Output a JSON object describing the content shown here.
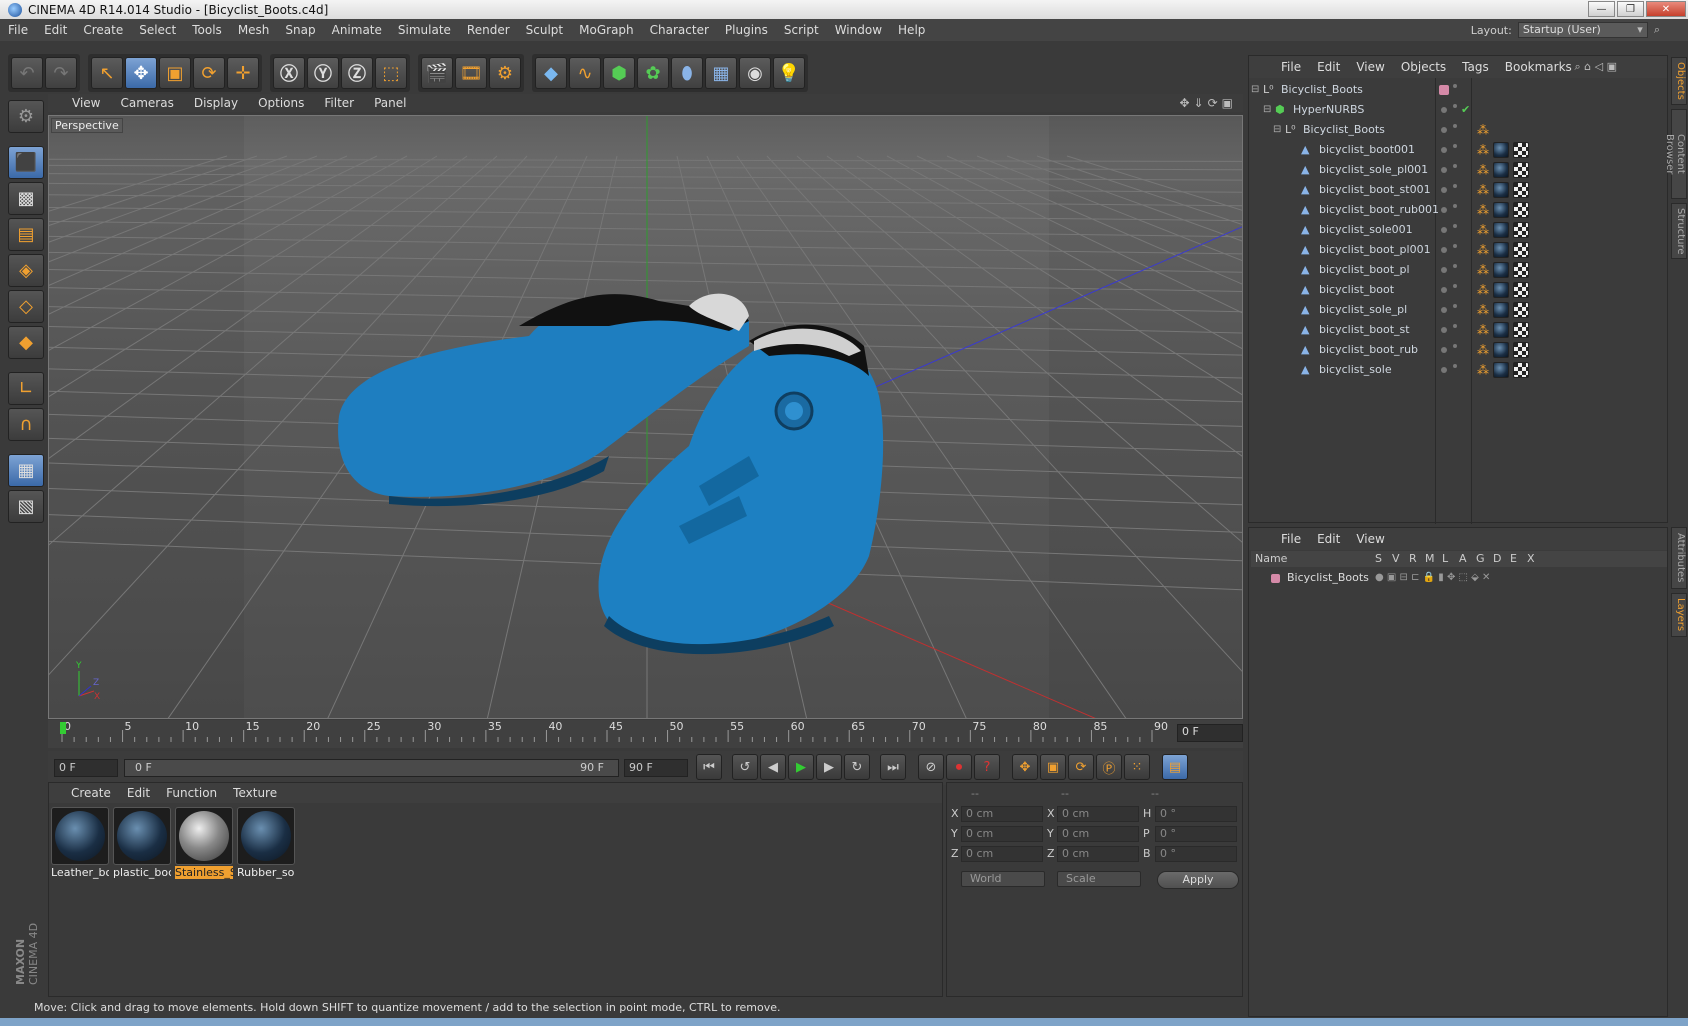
{
  "window": {
    "title": "CINEMA 4D R14.014 Studio - [Bicyclist_Boots.c4d]",
    "buttons": [
      "—",
      "❐",
      "✕"
    ]
  },
  "menubar": {
    "items": [
      "File",
      "Edit",
      "Create",
      "Select",
      "Tools",
      "Mesh",
      "Snap",
      "Animate",
      "Simulate",
      "Render",
      "Sculpt",
      "MoGraph",
      "Character",
      "Plugins",
      "Script",
      "Window",
      "Help"
    ],
    "layout_label": "Layout:",
    "layout_value": "Startup (User)"
  },
  "viewport": {
    "menu": [
      "View",
      "Cameras",
      "Display",
      "Options",
      "Filter",
      "Panel"
    ],
    "label": "Perspective",
    "axis_y": "Y",
    "axis_z": "Z",
    "axis_x": "X",
    "object_color": "#1a78b8"
  },
  "timeline": {
    "ticks": [
      "0",
      "5",
      "10",
      "15",
      "20",
      "25",
      "30",
      "35",
      "40",
      "45",
      "50",
      "55",
      "60",
      "65",
      "70",
      "75",
      "80",
      "85",
      "90"
    ],
    "current_frame": "0 F"
  },
  "transport": {
    "start_field": "0 F",
    "range_start": "0 F",
    "range_end": "90 F",
    "end_field": "90 F"
  },
  "materials": {
    "menu": [
      "Create",
      "Edit",
      "Function",
      "Texture"
    ],
    "items": [
      {
        "label": "Leather_bo",
        "selected": false,
        "kind": "dark"
      },
      {
        "label": "plastic_boc",
        "selected": false,
        "kind": "dark"
      },
      {
        "label": "Stainless_S",
        "selected": true,
        "kind": "steel"
      },
      {
        "label": "Rubber_so",
        "selected": false,
        "kind": "dark"
      }
    ]
  },
  "coordinates": {
    "headers": [
      "--",
      "--",
      "--"
    ],
    "rows": [
      {
        "a": "X",
        "av": "0 cm",
        "b": "X",
        "bv": "0 cm",
        "c": "H",
        "cv": "0 °"
      },
      {
        "a": "Y",
        "av": "0 cm",
        "b": "Y",
        "bv": "0 cm",
        "c": "P",
        "cv": "0 °"
      },
      {
        "a": "Z",
        "av": "0 cm",
        "b": "Z",
        "bv": "0 cm",
        "c": "B",
        "cv": "0 °"
      }
    ],
    "mode1": "World",
    "mode2": "Scale",
    "apply": "Apply"
  },
  "status": "Move: Click and drag to move elements. Hold down SHIFT to quantize movement / add to the selection in point mode, CTRL to remove.",
  "objects": {
    "menu": [
      "File",
      "Edit",
      "View",
      "Objects",
      "Tags",
      "Bookmarks"
    ],
    "rows": [
      {
        "name": "Bicyclist_Boots",
        "indent": 0,
        "type": "null",
        "tags": "layer"
      },
      {
        "name": "HyperNURBS",
        "indent": 1,
        "type": "nurbs",
        "tags": "check"
      },
      {
        "name": "Bicyclist_Boots",
        "indent": 2,
        "type": "null",
        "tags": "phong"
      },
      {
        "name": "bicyclist_boot001",
        "indent": 3,
        "type": "poly",
        "tags": "full"
      },
      {
        "name": "bicyclist_sole_pl001",
        "indent": 3,
        "type": "poly",
        "tags": "full"
      },
      {
        "name": "bicyclist_boot_st001",
        "indent": 3,
        "type": "poly",
        "tags": "full"
      },
      {
        "name": "bicyclist_boot_rub001",
        "indent": 3,
        "type": "poly",
        "tags": "full"
      },
      {
        "name": "bicyclist_sole001",
        "indent": 3,
        "type": "poly",
        "tags": "full"
      },
      {
        "name": "bicyclist_boot_pl001",
        "indent": 3,
        "type": "poly",
        "tags": "full"
      },
      {
        "name": "bicyclist_boot_pl",
        "indent": 3,
        "type": "poly",
        "tags": "full"
      },
      {
        "name": "bicyclist_boot",
        "indent": 3,
        "type": "poly",
        "tags": "full"
      },
      {
        "name": "bicyclist_sole_pl",
        "indent": 3,
        "type": "poly",
        "tags": "full"
      },
      {
        "name": "bicyclist_boot_st",
        "indent": 3,
        "type": "poly",
        "tags": "full"
      },
      {
        "name": "bicyclist_boot_rub",
        "indent": 3,
        "type": "poly",
        "tags": "full"
      },
      {
        "name": "bicyclist_sole",
        "indent": 3,
        "type": "poly",
        "tags": "full"
      }
    ]
  },
  "layers": {
    "menu": [
      "File",
      "Edit",
      "View"
    ],
    "columns": [
      "Name",
      "S",
      "V",
      "R",
      "M",
      "L",
      "A",
      "G",
      "D",
      "E",
      "X"
    ],
    "rows": [
      {
        "name": "Bicyclist_Boots",
        "color": "#d58aa8"
      }
    ]
  },
  "sidetabs": {
    "objects": "Objects",
    "content": "Content Browser",
    "structure": "Structure",
    "attributes": "Attributes",
    "layers": "Layers"
  },
  "brand": {
    "line1": "MAXON",
    "line2": "CINEMA 4D"
  }
}
